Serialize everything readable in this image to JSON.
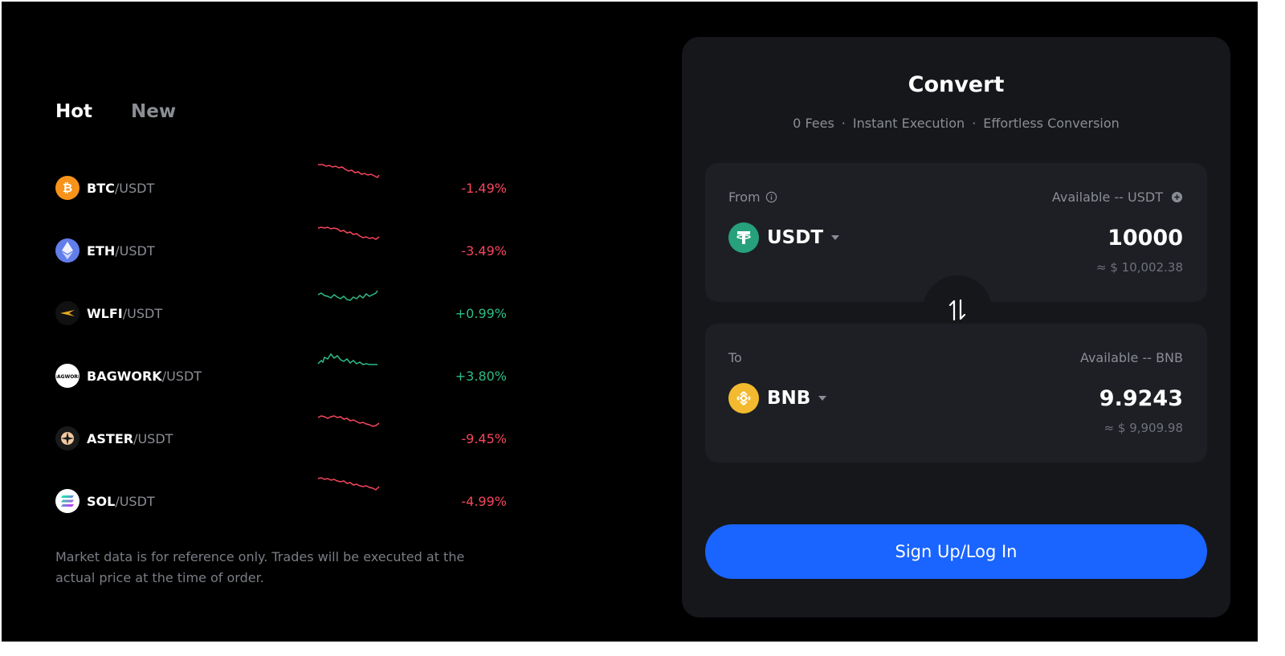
{
  "tabs": {
    "hot": "Hot",
    "new": "New",
    "active": "hot"
  },
  "markets": [
    {
      "base": "BTC",
      "quote": "USDT",
      "sep": "/",
      "change": "-1.49%",
      "trend": "down",
      "icon": "bitcoin-icon",
      "color": "#f7931a"
    },
    {
      "base": "ETH",
      "quote": "USDT",
      "sep": "/",
      "change": "-3.49%",
      "trend": "down",
      "icon": "ethereum-icon",
      "color": "#627eea"
    },
    {
      "base": "WLFI",
      "quote": "USDT",
      "sep": "/",
      "change": "+0.99%",
      "trend": "up",
      "icon": "wlfi-icon",
      "color": "#111111"
    },
    {
      "base": "BAGWORK",
      "quote": "USDT",
      "sep": "/",
      "change": "+3.80%",
      "trend": "up",
      "icon": "bagwork-icon",
      "color": "#ffffff"
    },
    {
      "base": "ASTER",
      "quote": "USDT",
      "sep": "/",
      "change": "-9.45%",
      "trend": "down",
      "icon": "aster-icon",
      "color": "#1a1a1a"
    },
    {
      "base": "SOL",
      "quote": "USDT",
      "sep": "/",
      "change": "-4.99%",
      "trend": "down",
      "icon": "solana-icon",
      "color": "#ffffff"
    }
  ],
  "disclaimer": "Market data is for reference only. Trades will be executed at the actual price at the time of order.",
  "convert": {
    "title": "Convert",
    "features": [
      "0 Fees",
      "Instant Execution",
      "Effortless Conversion"
    ],
    "feature_dot": "·",
    "from": {
      "label": "From",
      "available": "Available -- USDT",
      "token": "USDT",
      "amount": "10000",
      "approx": "≈ $ 10,002.38",
      "token_color": "#26a17b"
    },
    "to": {
      "label": "To",
      "available": "Available -- BNB",
      "token": "BNB",
      "amount": "9.9243",
      "approx": "≈ $ 9,909.98",
      "token_color": "#f3ba2f"
    },
    "cta": "Sign Up/Log In"
  },
  "colors": {
    "negative": "#f6465d",
    "positive": "#2ebd85",
    "accent": "#1a64ff",
    "panel": "#16171b"
  }
}
